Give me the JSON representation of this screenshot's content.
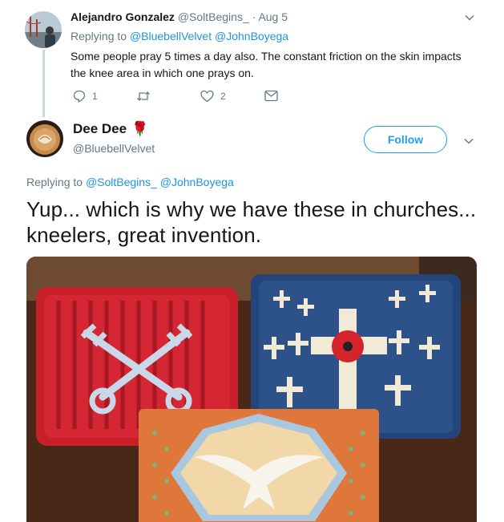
{
  "reply_tweet": {
    "name": "Alejandro Gonzalez",
    "handle": "@SoltBegins_",
    "dot": "·",
    "time": "Aug 5",
    "replying_prefix": "Replying to",
    "replying_to": [
      "@BluebellVelvet",
      "@JohnBoyega"
    ],
    "text": "Some people pray 5 times a day also. The constant friction on the skin impacts the knee area in which one prays on.",
    "reply_count": "1",
    "retweet_count": "",
    "like_count": "2",
    "icons": [
      "reply-icon",
      "retweet-icon",
      "heart-icon",
      "message-icon",
      "chevron-down-icon"
    ]
  },
  "main_tweet": {
    "name": "Dee Dee",
    "emoji": "🌹",
    "handle": "@BluebellVelvet",
    "follow_label": "Follow",
    "replying_prefix": "Replying to",
    "replying_to": [
      "@SoltBegins_",
      "@JohnBoyega"
    ],
    "text": "Yup... which is why we have these in churches... kneelers, great invention."
  },
  "colors": {
    "link": "#1b95e0",
    "follow_border": "#1da1f2",
    "muted": "#657786",
    "thread_line": "#ccd6dd"
  }
}
